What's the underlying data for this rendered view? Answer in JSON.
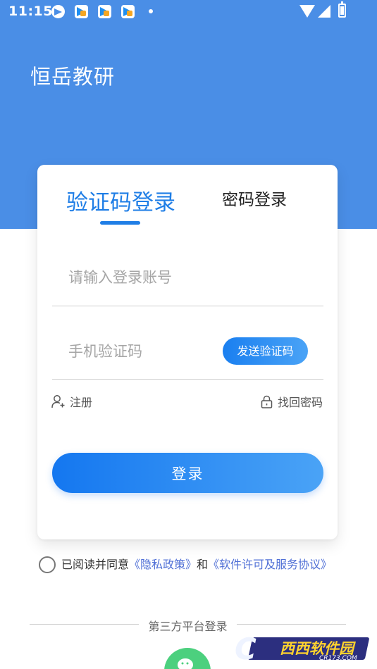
{
  "status_bar": {
    "time": "11:15",
    "icons": [
      "telegram-icon",
      "app-icon",
      "app-icon",
      "app-icon",
      "notification-dot-icon",
      "wifi-icon",
      "signal-icon",
      "battery-icon"
    ]
  },
  "header": {
    "app_title": "恒岳教研"
  },
  "login": {
    "tabs": [
      {
        "label": "验证码登录",
        "active": true
      },
      {
        "label": "密码登录",
        "active": false
      }
    ],
    "account_placeholder": "请输入登录账号",
    "code_placeholder": "手机验证码",
    "send_code_label": "发送验证码",
    "register_label": "注册",
    "forgot_label": "找回密码",
    "submit_label": "登录"
  },
  "agreement": {
    "prefix": "已阅读并同意",
    "privacy_link": "《隐私政策》",
    "conjunction": "和",
    "license_link": "《软件许可及服务协议》"
  },
  "third_party": {
    "label": "第三方平台登录",
    "providers": [
      "wechat-icon"
    ]
  },
  "watermark": {
    "logo_text": "西西软件园",
    "domain": "CR173.COM"
  },
  "colors": {
    "brand_blue": "#4a8ee6",
    "accent": "#1f7ee6",
    "wechat_green": "#4cd07e",
    "link": "#4f6fd6"
  }
}
